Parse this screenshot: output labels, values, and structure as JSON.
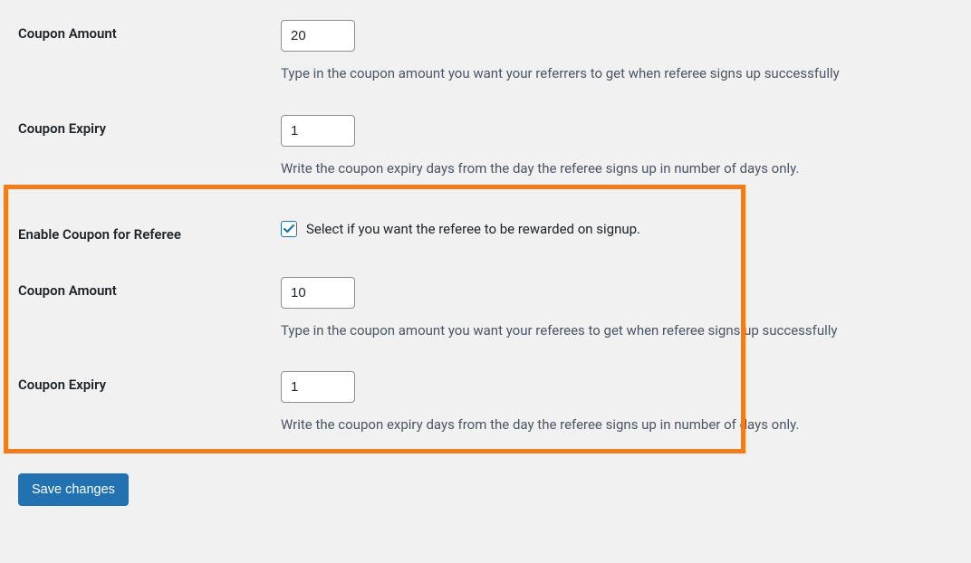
{
  "referrer": {
    "coupon_amount": {
      "label": "Coupon Amount",
      "value": "20",
      "desc": "Type in the coupon amount you want your referrers to get when referee signs up successfully"
    },
    "coupon_expiry": {
      "label": "Coupon Expiry",
      "value": "1",
      "desc": "Write the coupon expiry days from the day the referee signs up in number of days only."
    }
  },
  "referee": {
    "enable": {
      "label": "Enable Coupon for Referee",
      "checkbox_label": "Select if you want the referee to be rewarded on signup.",
      "checked": true
    },
    "coupon_amount": {
      "label": "Coupon Amount",
      "value": "10",
      "desc": "Type in the coupon amount you want your referees to get when referee signs up successfully"
    },
    "coupon_expiry": {
      "label": "Coupon Expiry",
      "value": "1",
      "desc": "Write the coupon expiry days from the day the referee signs up in number of days only."
    }
  },
  "submit": {
    "label": "Save changes"
  }
}
